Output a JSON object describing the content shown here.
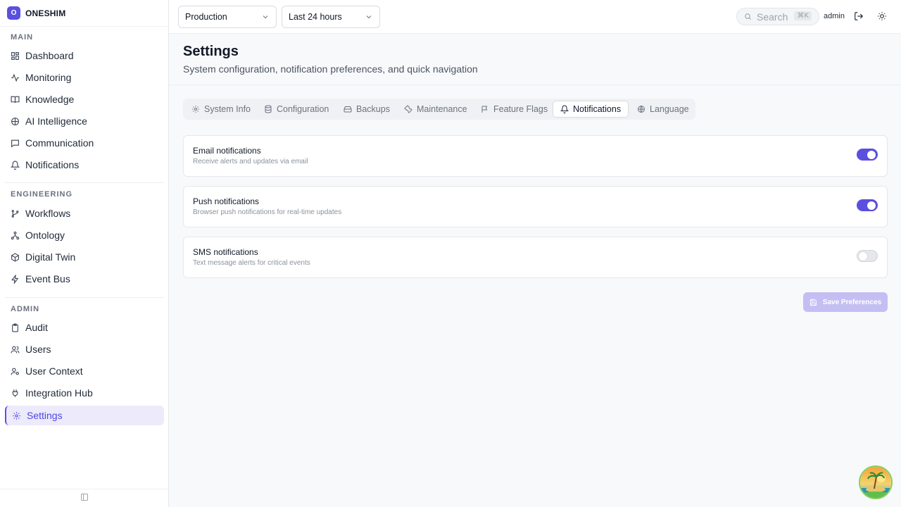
{
  "brand": {
    "logo_letter": "O",
    "name": "ONESHIM"
  },
  "sidebar": {
    "sections": [
      {
        "label": "MAIN",
        "items": [
          {
            "label": "Dashboard",
            "icon": "grid-icon"
          },
          {
            "label": "Monitoring",
            "icon": "activity-icon"
          },
          {
            "label": "Knowledge",
            "icon": "book-icon"
          },
          {
            "label": "AI Intelligence",
            "icon": "brain-icon"
          },
          {
            "label": "Communication",
            "icon": "message-icon"
          },
          {
            "label": "Notifications",
            "icon": "bell-icon"
          }
        ]
      },
      {
        "label": "ENGINEERING",
        "items": [
          {
            "label": "Workflows",
            "icon": "git-branch-icon"
          },
          {
            "label": "Ontology",
            "icon": "network-icon"
          },
          {
            "label": "Digital Twin",
            "icon": "box-icon"
          },
          {
            "label": "Event Bus",
            "icon": "zap-icon"
          }
        ]
      },
      {
        "label": "ADMIN",
        "items": [
          {
            "label": "Audit",
            "icon": "clipboard-icon"
          },
          {
            "label": "Users",
            "icon": "users-icon"
          },
          {
            "label": "User Context",
            "icon": "user-cog-icon"
          },
          {
            "label": "Integration Hub",
            "icon": "plug-icon"
          },
          {
            "label": "Settings",
            "icon": "gear-icon",
            "active": true
          }
        ]
      }
    ]
  },
  "topbar": {
    "environment": "Production",
    "time_range": "Last 24 hours",
    "search_placeholder": "Search",
    "search_shortcut": "⌘K",
    "user": "admin"
  },
  "page": {
    "title": "Settings",
    "subtitle": "System configuration, notification preferences, and quick navigation"
  },
  "tabs": [
    {
      "label": "System Info",
      "icon": "gear-icon"
    },
    {
      "label": "Configuration",
      "icon": "database-icon"
    },
    {
      "label": "Backups",
      "icon": "hard-drive-icon"
    },
    {
      "label": "Maintenance",
      "icon": "wrench-icon"
    },
    {
      "label": "Feature Flags",
      "icon": "flag-icon"
    },
    {
      "label": "Notifications",
      "icon": "bell-icon",
      "active": true
    },
    {
      "label": "Language",
      "icon": "globe-icon"
    }
  ],
  "notifications": [
    {
      "title": "Email notifications",
      "description": "Receive alerts and updates via email",
      "enabled": true
    },
    {
      "title": "Push notifications",
      "description": "Browser push notifications for real-time updates",
      "enabled": true
    },
    {
      "title": "SMS notifications",
      "description": "Text message alerts for critical events",
      "enabled": false
    }
  ],
  "save_button": "Save Preferences",
  "colors": {
    "accent": "#5b4fe0",
    "accent_soft": "#eceafb",
    "button_disabled": "#c4bff3"
  }
}
